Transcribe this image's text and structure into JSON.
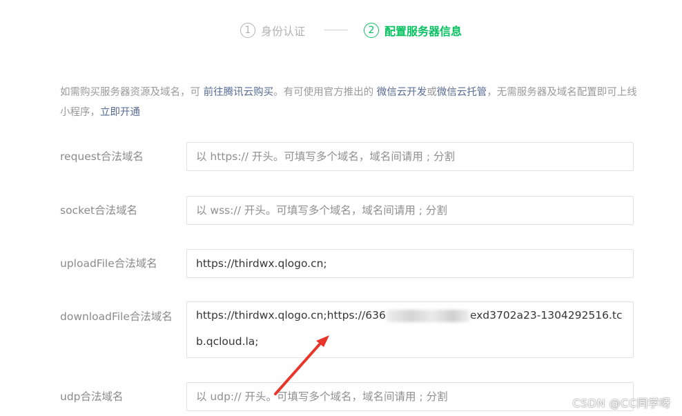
{
  "steps": [
    {
      "num": "1",
      "label": "身份认证",
      "active": false
    },
    {
      "num": "2",
      "label": "配置服务器信息",
      "active": true
    }
  ],
  "notice": {
    "text1": "如需购买服务器资源及域名，可 ",
    "link1": "前往腾讯云购买",
    "text2": "。有可使用官方推出的 ",
    "link2": "微信云开发",
    "text3": "或",
    "link3": "微信云托管",
    "text4": "，无需服务器及域名配置即可上线小程序，",
    "link4": "立即开通"
  },
  "fields": {
    "request": {
      "label": "request合法域名",
      "placeholder": "以 https:// 开头。可填写多个域名，域名间请用 ; 分割",
      "value": ""
    },
    "socket": {
      "label": "socket合法域名",
      "placeholder": "以 wss:// 开头。可填写多个域名，域名间请用 ; 分割",
      "value": ""
    },
    "uploadFile": {
      "label": "uploadFile合法域名",
      "placeholder": "",
      "value": "https://thirdwx.qlogo.cn;"
    },
    "downloadFile": {
      "label": "downloadFile合法域名",
      "value_start": "https://thirdwx.qlogo.cn;https://636",
      "value_end": "exd3702a23-1304292516.tcb.qcloud.la;"
    },
    "udp": {
      "label": "udp合法域名",
      "placeholder": "以 udp:// 开头。可填写多个域名，域名间请用 ; 分割",
      "value": ""
    }
  },
  "annotation": {
    "arrow_color": "#e8362a"
  },
  "watermark": "CSDN @CC同学呀",
  "colors": {
    "accent": "#07c160",
    "link": "#576b95",
    "muted": "#b2b2b2"
  }
}
